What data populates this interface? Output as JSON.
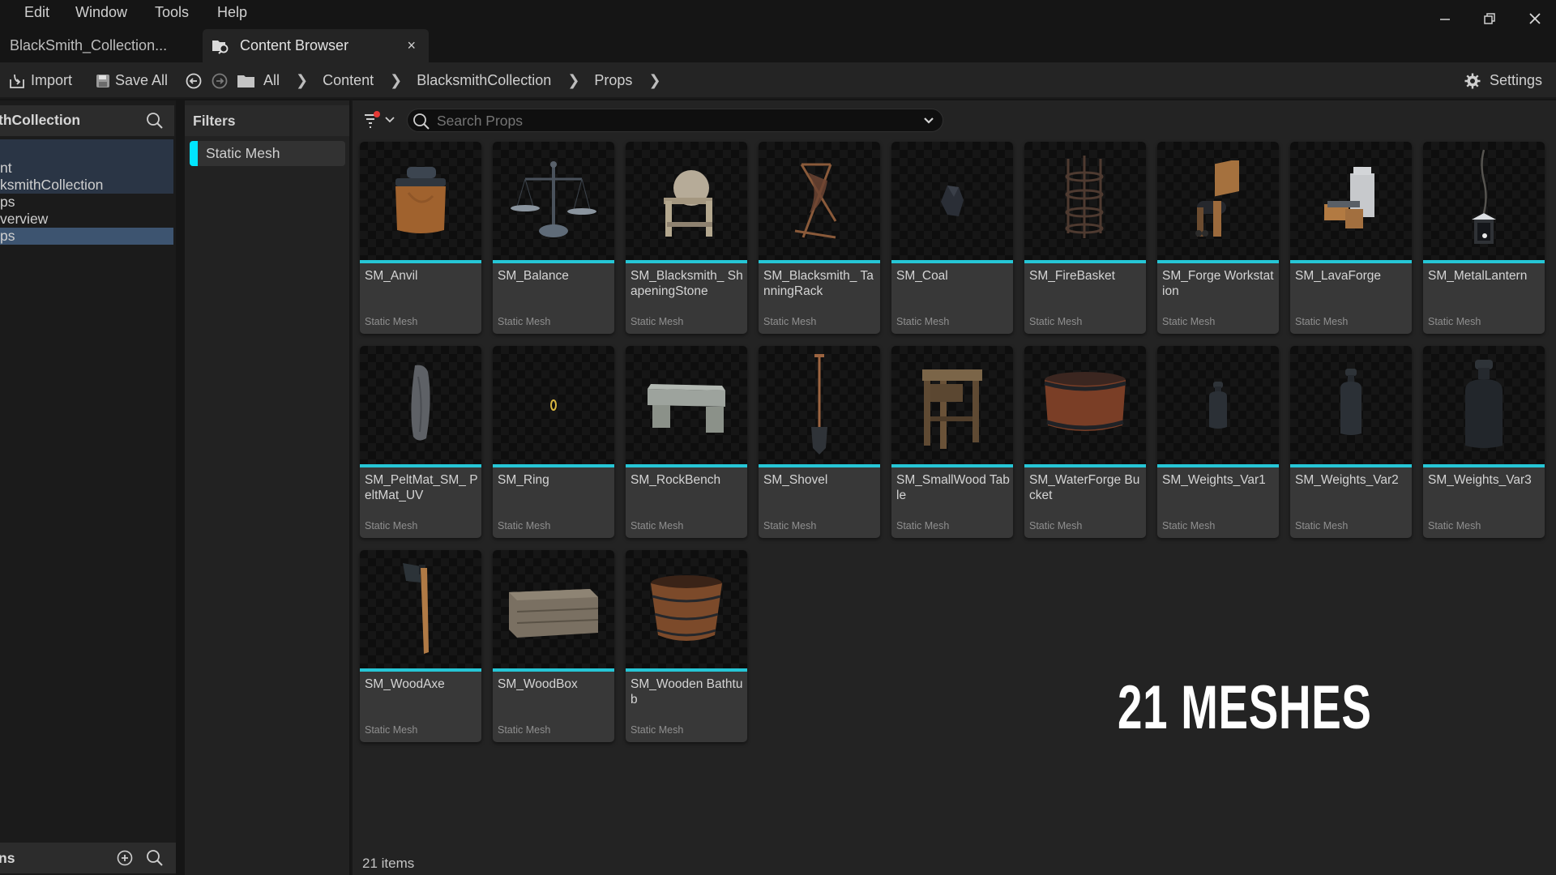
{
  "menu": {
    "items": [
      "Edit",
      "Window",
      "Tools",
      "Help"
    ]
  },
  "window_controls": {
    "minimize": "minimize-icon",
    "restore": "restore-icon",
    "close": "close-icon"
  },
  "tabs": [
    {
      "label": "BlackSmith_Collection...",
      "active": false
    },
    {
      "label": "Content Browser",
      "active": true,
      "icon": "content-browser-icon",
      "close_label": "×"
    }
  ],
  "toolbar": {
    "import_label": "Import",
    "save_all_label": "Save All",
    "settings_label": "Settings",
    "breadcrumb": [
      "All",
      "Content",
      "BlacksmithCollection",
      "Props"
    ]
  },
  "left_panel": {
    "header_title": "thCollection",
    "tree": [
      {
        "label": "nt",
        "selected": false,
        "highlight": true
      },
      {
        "label": "ksmithCollection",
        "selected": false,
        "highlight": true
      },
      {
        "label": "ps",
        "selected": false,
        "highlight": false
      },
      {
        "label": "verview",
        "selected": false,
        "highlight": false
      },
      {
        "label": "ps",
        "selected": true,
        "highlight": false
      }
    ],
    "bottom_title": "ns"
  },
  "filters": {
    "header": "Filters",
    "active_filter": "Static Mesh",
    "filter_color": "#00e5ff"
  },
  "search": {
    "placeholder": "Search Props",
    "value": ""
  },
  "assets": [
    {
      "name": "SM_Anvil",
      "type": "Static Mesh",
      "thumb": "anvil"
    },
    {
      "name": "SM_Balance",
      "type": "Static Mesh",
      "thumb": "balance"
    },
    {
      "name": "SM_Blacksmith_ ShapeningStone",
      "type": "Static Mesh",
      "thumb": "stone"
    },
    {
      "name": "SM_Blacksmith_ TanningRack",
      "type": "Static Mesh",
      "thumb": "rack"
    },
    {
      "name": "SM_Coal",
      "type": "Static Mesh",
      "thumb": "coal"
    },
    {
      "name": "SM_FireBasket",
      "type": "Static Mesh",
      "thumb": "basket"
    },
    {
      "name": "SM_Forge Workstation",
      "type": "Static Mesh",
      "thumb": "forge"
    },
    {
      "name": "SM_LavaForge",
      "type": "Static Mesh",
      "thumb": "lavaforge"
    },
    {
      "name": "SM_MetalLantern",
      "type": "Static Mesh",
      "thumb": "lantern"
    },
    {
      "name": "SM_PeltMat_SM_ PeltMat_UV",
      "type": "Static Mesh",
      "thumb": "pelt"
    },
    {
      "name": "SM_Ring",
      "type": "Static Mesh",
      "thumb": "ring"
    },
    {
      "name": "SM_RockBench",
      "type": "Static Mesh",
      "thumb": "bench"
    },
    {
      "name": "SM_Shovel",
      "type": "Static Mesh",
      "thumb": "shovel"
    },
    {
      "name": "SM_SmallWood Table",
      "type": "Static Mesh",
      "thumb": "table"
    },
    {
      "name": "SM_WaterForge Bucket",
      "type": "Static Mesh",
      "thumb": "bucket"
    },
    {
      "name": "SM_Weights_Var1",
      "type": "Static Mesh",
      "thumb": "weight1"
    },
    {
      "name": "SM_Weights_Var2",
      "type": "Static Mesh",
      "thumb": "weight2"
    },
    {
      "name": "SM_Weights_Var3",
      "type": "Static Mesh",
      "thumb": "weight3"
    },
    {
      "name": "SM_WoodAxe",
      "type": "Static Mesh",
      "thumb": "axe"
    },
    {
      "name": "SM_WoodBox",
      "type": "Static Mesh",
      "thumb": "box"
    },
    {
      "name": "SM_Wooden Bathtub",
      "type": "Static Mesh",
      "thumb": "bathtub"
    }
  ],
  "overlay_text": "21 MESHES",
  "status": {
    "items_count": "21 items"
  },
  "colors": {
    "accent_cyan": "#26c6d6",
    "filter_dot": "#e53935",
    "selected_row": "#3d5470",
    "highlight_rows": "#2a3545"
  }
}
